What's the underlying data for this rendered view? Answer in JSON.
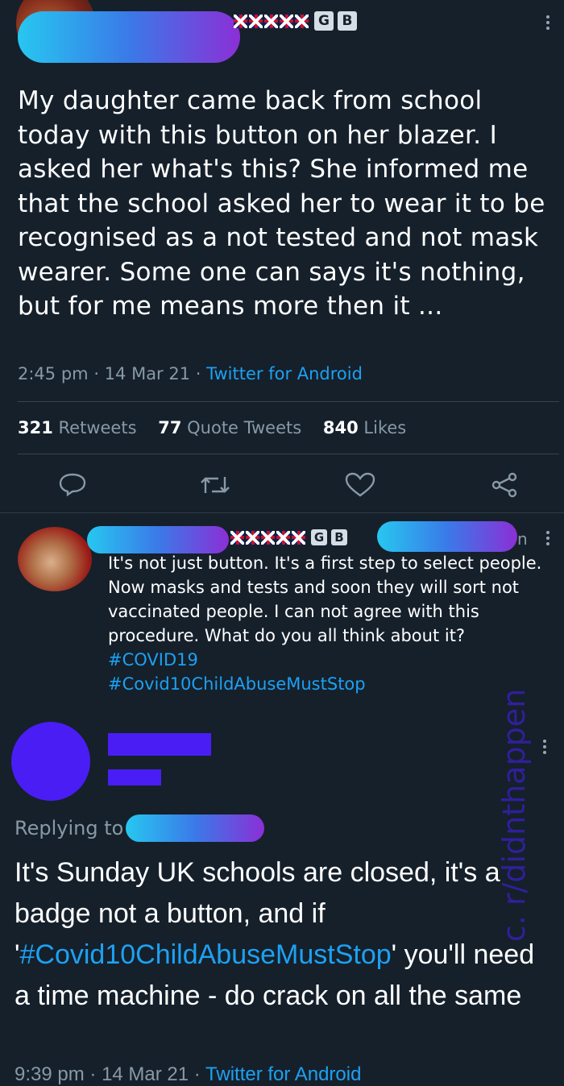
{
  "tweet": {
    "text": "My daughter came back from school today with this button on her blazer. I asked her what's this? She informed me that the school asked her to wear it  to be recognised as a not tested and not mask wearer. Some one can says it's nothing, but for me means more then it ...",
    "time": "2:45 pm",
    "date": "14 Mar 21",
    "client": "Twitter for Android",
    "stats": {
      "retweets_count": "321",
      "retweets_label": "Retweets",
      "quotes_count": "77",
      "quotes_label": "Quote Tweets",
      "likes_count": "840",
      "likes_label": "Likes"
    },
    "badges": [
      "G",
      "B"
    ]
  },
  "reply": {
    "text": "It's not just button. It's a first step to select people. Now masks and tests and soon they will sort not vaccinated people. I can not agree with this procedure. What do you all think about it?",
    "hashtags": [
      "#COVID19",
      "#Covid10ChildAbuseMustStop"
    ],
    "badges": [
      "G",
      "B"
    ],
    "trail": "n"
  },
  "response": {
    "replying_to": "Replying to",
    "text_before": "It's Sunday UK schools are closed, it's a badge not a button, and if '",
    "hashtag": "#Covid10ChildAbuseMustStop",
    "text_after": "' you'll need a time machine - do crack on all the same",
    "time": "9:39 pm",
    "date": "14 Mar 21",
    "client": "Twitter for Android"
  },
  "watermark": "c. r/didnthappen",
  "colors": {
    "background": "#15202b",
    "link": "#1da1f2",
    "muted": "#8899a6",
    "redaction": "#4a1df5"
  }
}
